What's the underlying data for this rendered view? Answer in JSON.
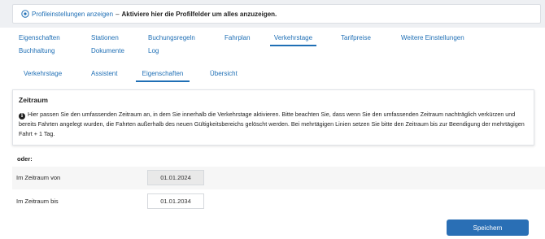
{
  "profile_bar": {
    "link_text": "Profileinstellungen anzeigen",
    "separator": "–",
    "hint_text": "Aktiviere hier die Profilfelder um alles anzuzeigen."
  },
  "main_tabs": [
    {
      "label": "Eigenschaften",
      "active": false
    },
    {
      "label": "Stationen",
      "active": false
    },
    {
      "label": "Buchungsregeln",
      "active": false
    },
    {
      "label": "Fahrplan",
      "active": false
    },
    {
      "label": "Verkehrstage",
      "active": true
    },
    {
      "label": "Tarifpreise",
      "active": false
    },
    {
      "label": "Weitere Einstellungen",
      "active": false
    },
    {
      "label": "Buchhaltung",
      "active": false
    },
    {
      "label": "Dokumente",
      "active": false
    },
    {
      "label": "Log",
      "active": false
    }
  ],
  "sub_tabs": [
    {
      "label": "Verkehrstage",
      "active": false
    },
    {
      "label": "Assistent",
      "active": false
    },
    {
      "label": "Eigenschaften",
      "active": true
    },
    {
      "label": "Übersicht",
      "active": false
    }
  ],
  "infobox": {
    "title": "Zeitraum",
    "icon": "info-circle-icon",
    "text": "Hier passen Sie den umfassenden Zeitraum an, in dem Sie innerhalb die Verkehrstage aktivieren. Bitte beachten Sie, dass wenn Sie den umfassenden Zeitraum nachträglich verkürzen und bereits Fahrten angelegt wurden, die Fahrten außerhalb des neuen Gültigkeitsbereichs gelöscht werden. Bei mehrtägigen Linien setzen Sie bitte den Zeitraum bis zur Beendigung der mehrtägigen Fahrt + 1 Tag."
  },
  "form": {
    "oder_label": "oder:",
    "from_label": "Im Zeitraum von",
    "from_value": "01.01.2024",
    "to_label": "Im Zeitraum bis",
    "to_value": "01.01.2034"
  },
  "save_label": "Speichern",
  "colors": {
    "accent": "#1f6fb5",
    "button": "#2a6fb5",
    "background": "#eef0f3"
  }
}
